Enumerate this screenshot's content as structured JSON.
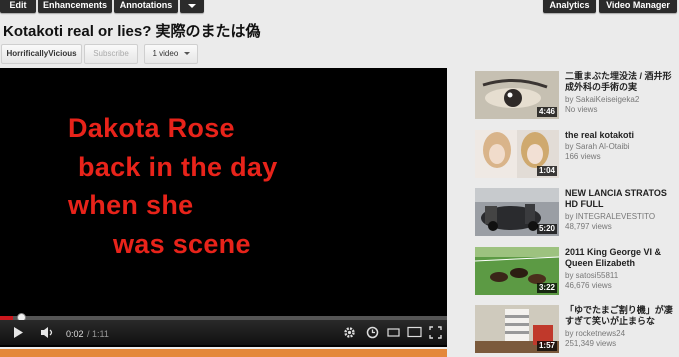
{
  "toolbar": {
    "edit": "Edit",
    "enhancements": "Enhancements",
    "annotations": "Annotations",
    "analytics": "Analytics",
    "video_manager": "Video Manager"
  },
  "video": {
    "title": "Kotakoti real or lies? 実際のまたは偽",
    "channel": "HorrificallyVicious",
    "subscribe": "Subscribe",
    "video_count": "1 video",
    "overlay_lines": [
      "Dakota Rose",
      "back in the day",
      "when she",
      "was scene"
    ],
    "current_time": "0:02",
    "duration": "/ 1:11",
    "progress_fraction": 0.028
  },
  "sidebar": {
    "items": [
      {
        "title": "二重まぶた埋没法 / 酒井形成外科の手術の実",
        "by": "by SakaiKeiseigeka2",
        "views": "No views",
        "duration": "4:46",
        "thumb_color": "#b7b2a6"
      },
      {
        "title": "the real kotakoti",
        "by": "by Sarah Al-Otaibi",
        "views": "166 views",
        "duration": "1:04",
        "thumb_color": "#d8c9c0"
      },
      {
        "title": "NEW LANCIA STRATOS HD FULL",
        "by": "by INTEGRALEVESTITO",
        "views": "48,797 views",
        "duration": "5:20",
        "thumb_color": "#8a8d92"
      },
      {
        "title": "2011 King George VI & Queen Elizabeth",
        "by": "by satosi55811",
        "views": "46,676 views",
        "duration": "3:22",
        "thumb_color": "#4f8a3c"
      },
      {
        "title": "「ゆでたまご割り機」が凄すぎて笑いが止まらな",
        "by": "by rocketnews24",
        "views": "251,349 views",
        "duration": "1:57",
        "thumb_color": "#c9c4b8"
      }
    ]
  }
}
